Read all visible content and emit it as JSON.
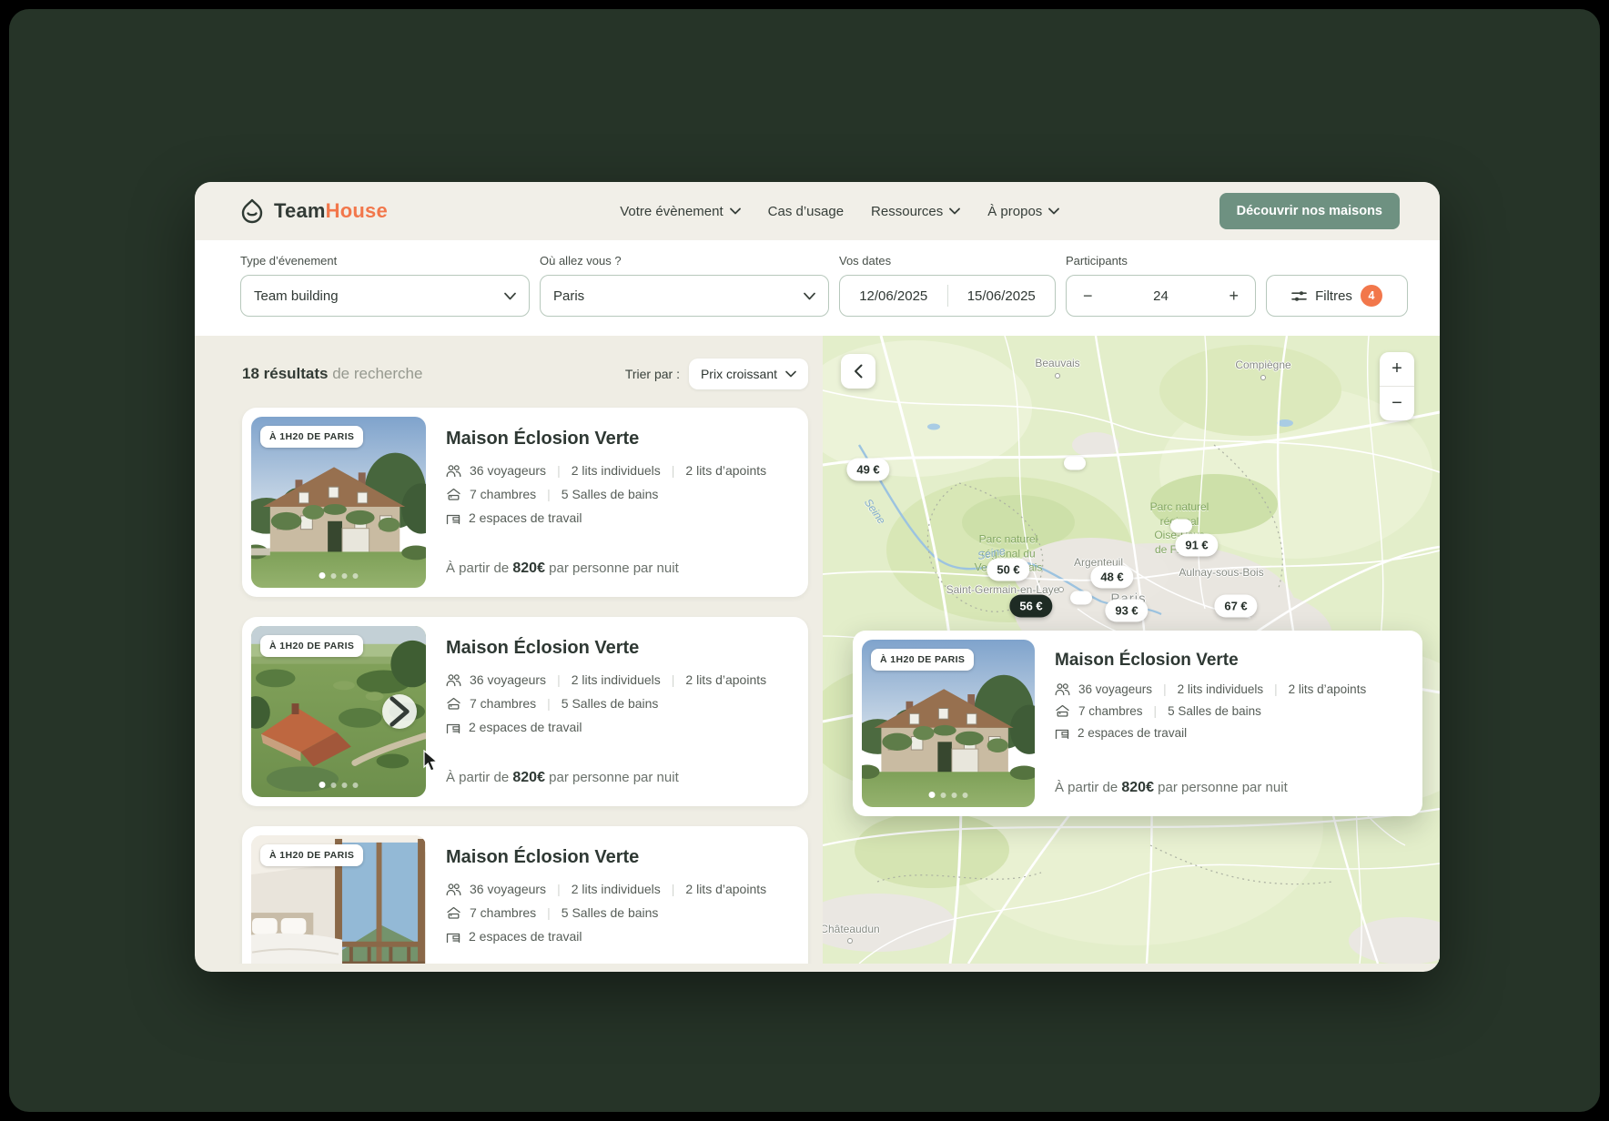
{
  "header": {
    "brand": {
      "part1": "Team",
      "part2": "House"
    },
    "nav": [
      {
        "label": "Votre évènement"
      },
      {
        "label": "Cas d’usage"
      },
      {
        "label": "Ressources"
      },
      {
        "label": "À propos"
      }
    ],
    "cta": "Découvrir nos maisons"
  },
  "search": {
    "event": {
      "label": "Type d’évenement",
      "value": "Team building"
    },
    "destination": {
      "label": "Où allez vous ?",
      "value": "Paris"
    },
    "dates": {
      "label": "Vos dates",
      "start": "12/06/2025",
      "end": "15/06/2025"
    },
    "participants": {
      "label": "Participants",
      "value": "24",
      "decrease": "−",
      "increase": "+"
    },
    "filters": {
      "label": "Filtres",
      "badge": "4"
    }
  },
  "results": {
    "count": "18 résultats",
    "suffix": " de recherche",
    "sort_label": "Trier par :",
    "sort_value": "Prix croissant"
  },
  "listing": {
    "badge": "À 1H20 DE PARIS",
    "title": "Maison Éclosion Verte",
    "guests": "36 voyageurs",
    "single_beds": "2 lits individuels",
    "extra_beds": "2 lits d’apoints",
    "bedrooms": "7 chambres",
    "bathrooms": "5 Salles de bains",
    "workspaces": "2 espaces de travail",
    "price_prefix": "À partir de ",
    "price": "820€",
    "price_suffix": " par personne par nuit",
    "separator": "|"
  },
  "map": {
    "controls": {
      "zoom_in": "+",
      "zoom_out": "−"
    },
    "pins": [
      {
        "label": "49 €"
      },
      {
        "label": "91 €"
      },
      {
        "label": "50 €"
      },
      {
        "label": "48 €"
      },
      {
        "label": "56 €",
        "selected": true
      },
      {
        "label": "93 €"
      },
      {
        "label": "67 €"
      }
    ],
    "cities": [
      {
        "name": "Beauvais"
      },
      {
        "name": "Compiègne"
      },
      {
        "name": "Argenteuil"
      },
      {
        "name": "Aulnay-sous-Bois"
      },
      {
        "name": "Saint-Germain-en-Laye"
      },
      {
        "name": "Paris"
      },
      {
        "name": "Châteaudun"
      }
    ],
    "parks": [
      {
        "lines": [
          "Parc naturel",
          "régional du",
          "Vexin français"
        ]
      },
      {
        "lines": [
          "Parc naturel",
          "régional",
          "Oise-Pays",
          "de France"
        ]
      }
    ],
    "rivers": [
      {
        "name": "Seine"
      },
      {
        "name": "Seine"
      }
    ]
  },
  "colors": {
    "accent_orange": "#F2774B",
    "cta_green": "#6E9181",
    "background_dark": "#263428",
    "selected_pin": "#1E2B24"
  }
}
